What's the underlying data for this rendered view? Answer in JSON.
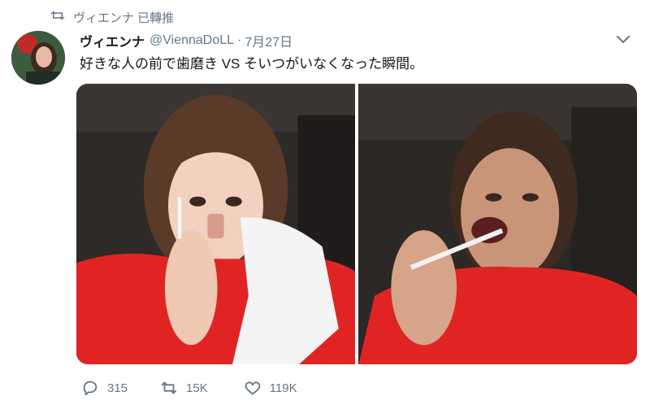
{
  "retweet_banner": {
    "icon": "retweet-icon",
    "text": "ヴィエンナ 已轉推"
  },
  "tweet": {
    "display_name": "ヴィエンナ",
    "handle": "@ViennaDoLL",
    "separator": "·",
    "date": "7月27日",
    "text": "好きな人の前で歯磨き VS そいつがいなくなった瞬間。"
  },
  "actions": {
    "reply": {
      "icon": "reply-icon",
      "count": "315"
    },
    "retweet": {
      "icon": "retweet-icon",
      "count": "15K"
    },
    "like": {
      "icon": "heart-icon",
      "count": "119K"
    }
  },
  "colors": {
    "secondary_text": "#657786",
    "shirt_red": "#e02424"
  }
}
